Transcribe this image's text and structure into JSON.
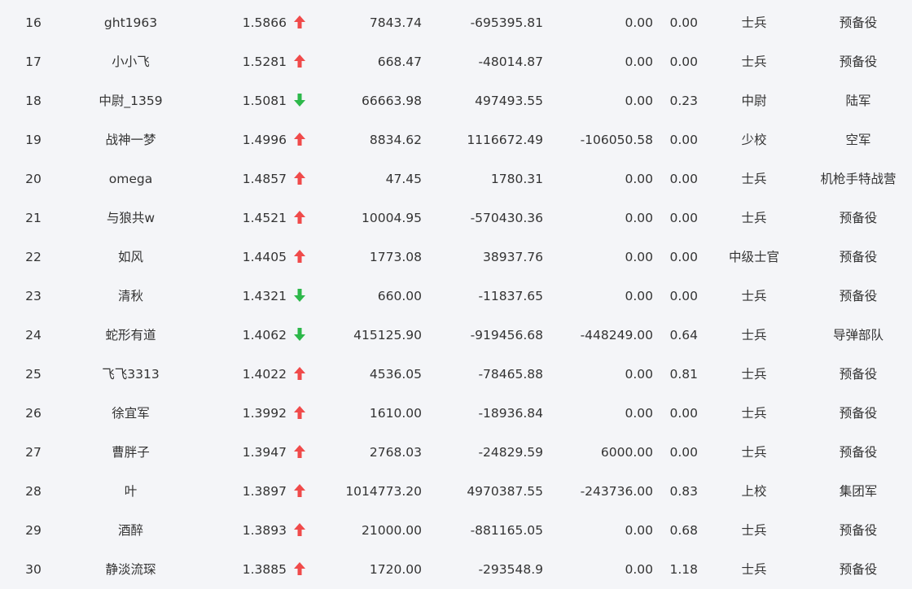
{
  "colors": {
    "up": "#f04a4a",
    "down": "#2db84a",
    "text": "#333333",
    "background": "#f4f5f8"
  },
  "rows": [
    {
      "rank": "16",
      "name": "ght1963",
      "ratio": "1.5866",
      "trend": "up",
      "c1": "7843.74",
      "c2": "-695395.81",
      "c3": "0.00",
      "c4": "0.00",
      "title": "士兵",
      "unit": "预备役"
    },
    {
      "rank": "17",
      "name": "小小飞",
      "ratio": "1.5281",
      "trend": "up",
      "c1": "668.47",
      "c2": "-48014.87",
      "c3": "0.00",
      "c4": "0.00",
      "title": "士兵",
      "unit": "预备役"
    },
    {
      "rank": "18",
      "name": "中尉_1359",
      "ratio": "1.5081",
      "trend": "down",
      "c1": "66663.98",
      "c2": "497493.55",
      "c3": "0.00",
      "c4": "0.23",
      "title": "中尉",
      "unit": "陆军"
    },
    {
      "rank": "19",
      "name": "战神一梦",
      "ratio": "1.4996",
      "trend": "up",
      "c1": "8834.62",
      "c2": "1116672.49",
      "c3": "-106050.58",
      "c4": "0.00",
      "title": "少校",
      "unit": "空军"
    },
    {
      "rank": "20",
      "name": "omega",
      "ratio": "1.4857",
      "trend": "up",
      "c1": "47.45",
      "c2": "1780.31",
      "c3": "0.00",
      "c4": "0.00",
      "title": "士兵",
      "unit": "机枪手特战营"
    },
    {
      "rank": "21",
      "name": "与狼共w",
      "ratio": "1.4521",
      "trend": "up",
      "c1": "10004.95",
      "c2": "-570430.36",
      "c3": "0.00",
      "c4": "0.00",
      "title": "士兵",
      "unit": "预备役"
    },
    {
      "rank": "22",
      "name": "如风",
      "ratio": "1.4405",
      "trend": "up",
      "c1": "1773.08",
      "c2": "38937.76",
      "c3": "0.00",
      "c4": "0.00",
      "title": "中级士官",
      "unit": "预备役"
    },
    {
      "rank": "23",
      "name": "清秋",
      "ratio": "1.4321",
      "trend": "down",
      "c1": "660.00",
      "c2": "-11837.65",
      "c3": "0.00",
      "c4": "0.00",
      "title": "士兵",
      "unit": "预备役"
    },
    {
      "rank": "24",
      "name": "蛇形有道",
      "ratio": "1.4062",
      "trend": "down",
      "c1": "415125.90",
      "c2": "-919456.68",
      "c3": "-448249.00",
      "c4": "0.64",
      "title": "士兵",
      "unit": "导弹部队"
    },
    {
      "rank": "25",
      "name": "飞飞3313",
      "ratio": "1.4022",
      "trend": "up",
      "c1": "4536.05",
      "c2": "-78465.88",
      "c3": "0.00",
      "c4": "0.81",
      "title": "士兵",
      "unit": "预备役"
    },
    {
      "rank": "26",
      "name": "徐宜军",
      "ratio": "1.3992",
      "trend": "up",
      "c1": "1610.00",
      "c2": "-18936.84",
      "c3": "0.00",
      "c4": "0.00",
      "title": "士兵",
      "unit": "预备役"
    },
    {
      "rank": "27",
      "name": "曹胖子",
      "ratio": "1.3947",
      "trend": "up",
      "c1": "2768.03",
      "c2": "-24829.59",
      "c3": "6000.00",
      "c4": "0.00",
      "title": "士兵",
      "unit": "预备役"
    },
    {
      "rank": "28",
      "name": "叶",
      "ratio": "1.3897",
      "trend": "up",
      "c1": "1014773.20",
      "c2": "4970387.55",
      "c3": "-243736.00",
      "c4": "0.83",
      "title": "上校",
      "unit": "集团军"
    },
    {
      "rank": "29",
      "name": "酒醉",
      "ratio": "1.3893",
      "trend": "up",
      "c1": "21000.00",
      "c2": "-881165.05",
      "c3": "0.00",
      "c4": "0.68",
      "title": "士兵",
      "unit": "预备役"
    },
    {
      "rank": "30",
      "name": "静淡流琛",
      "ratio": "1.3885",
      "trend": "up",
      "c1": "1720.00",
      "c2": "-293548.9",
      "c3": "0.00",
      "c4": "1.18",
      "title": "士兵",
      "unit": "预备役"
    }
  ]
}
